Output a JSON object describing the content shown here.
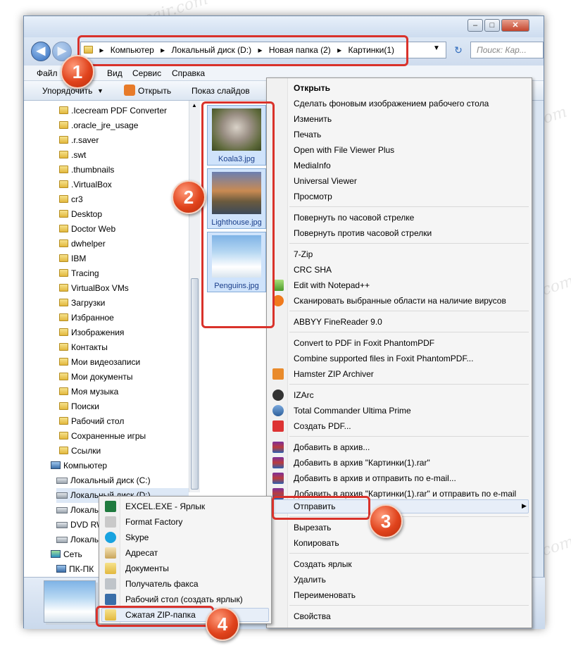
{
  "window": {
    "address": [
      "Компьютер",
      "Локальный диск (D:)",
      "Новая папка (2)",
      "Картинки(1)"
    ],
    "search_placeholder": "Поиск: Кар...",
    "menu": [
      "Файл",
      "Вид",
      "Сервис",
      "Справка"
    ],
    "toolbar": {
      "organize": "Упорядочить",
      "open": "Открыть",
      "slideshow": "Показ слайдов"
    }
  },
  "navigation": {
    "folders": [
      ".Icecream PDF Converter",
      ".oracle_jre_usage",
      ".r.saver",
      ".swt",
      ".thumbnails",
      ".VirtualBox",
      "cr3",
      "Desktop",
      "Doctor Web",
      "dwhelper",
      "IBM",
      "Tracing",
      "VirtualBox VMs",
      "Загрузки",
      "Избранное",
      "Изображения",
      "Контакты",
      "Мои видеозаписи",
      "Мои документы",
      "Моя музыка",
      "Поиски",
      "Рабочий стол",
      "Сохраненные игры",
      "Ссылки"
    ],
    "computer": "Компьютер",
    "drives": [
      "Локальный диск (C:)",
      "Локальный диск (D:)",
      "Локаль",
      "DVD RW",
      "Локаль"
    ],
    "network": "Сеть",
    "network_pc": "ПК-ПК"
  },
  "files": [
    {
      "name": "Koala3.jpg"
    },
    {
      "name": "Lighthouse.jpg"
    },
    {
      "name": "Penguins.jpg"
    }
  ],
  "context_menu": {
    "group1": [
      "Открыть",
      "Сделать фоновым изображением рабочего стола",
      "Изменить",
      "Печать",
      "Open with File Viewer Plus",
      "MediaInfo",
      "Universal Viewer",
      "Просмотр"
    ],
    "group2": [
      "Повернуть по часовой стрелке",
      "Повернуть против часовой стрелки"
    ],
    "group3": [
      "7-Zip",
      "CRC SHA",
      "Edit with Notepad++",
      "Сканировать выбранные области на наличие вирусов"
    ],
    "group4": [
      "ABBYY FineReader 9.0"
    ],
    "group5": [
      "Convert to PDF in Foxit PhantomPDF",
      "Combine supported files in Foxit PhantomPDF...",
      "Hamster ZIP Archiver"
    ],
    "group6": [
      "IZArc",
      "Total Commander Ultima Prime",
      "Создать PDF..."
    ],
    "group7": [
      "Добавить в архив...",
      "Добавить в архив \"Картинки(1).rar\"",
      "Добавить в архив и отправить по e-mail...",
      "Добавить в архив \"Картинки(1).rar\" и отправить по e-mail"
    ],
    "send_to": "Отправить",
    "group8": [
      "Вырезать",
      "Копировать"
    ],
    "group9": [
      "Создать ярлык",
      "Удалить",
      "Переименовать"
    ],
    "properties": "Свойства"
  },
  "send_to_menu": [
    "EXCEL.EXE - Ярлык",
    "Format Factory",
    "Skype",
    "Адресат",
    "Документы",
    "Получатель факса",
    "Рабочий стол (создать ярлык)",
    "Сжатая ZIP-папка"
  ],
  "badges": [
    "1",
    "2",
    "3",
    "4"
  ],
  "watermark": "Soringpcrepair.com",
  "colors": {
    "highlight": "#d9322b",
    "badge": "#e0431c",
    "selection": "#cfe3fb"
  }
}
